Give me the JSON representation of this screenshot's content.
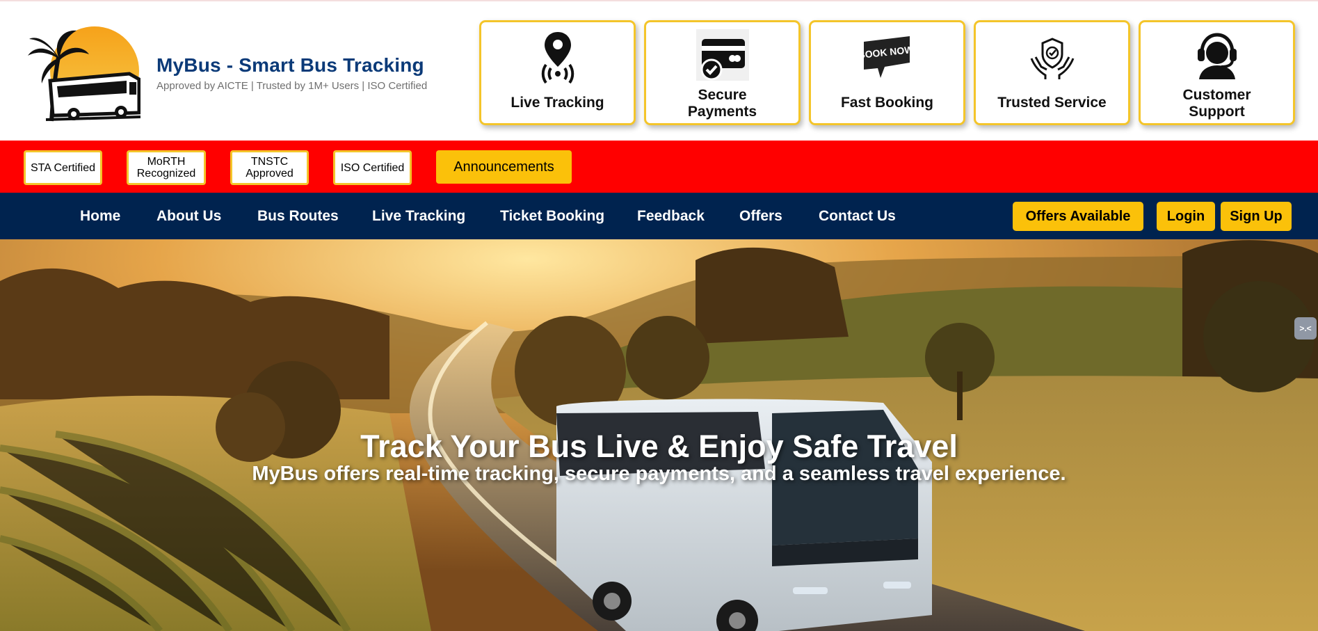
{
  "brand": {
    "title": "MyBus - Smart Bus Tracking",
    "subtitle": "Approved by AICTE | Trusted by 1M+ Users | ISO Certified",
    "logo_icon": "palm-bus-logo"
  },
  "features": [
    {
      "label": "Live Tracking",
      "icon": "location-pin-icon"
    },
    {
      "label": "Secure Payments",
      "icon": "card-check-icon"
    },
    {
      "label": "Fast Booking",
      "icon": "book-now-icon"
    },
    {
      "label": "Trusted Service",
      "icon": "shield-hands-icon"
    },
    {
      "label": "Customer Support",
      "icon": "headset-icon"
    }
  ],
  "certifications": [
    {
      "line1": "STA Certified",
      "line2": ""
    },
    {
      "line1": "MoRTH",
      "line2": "Recognized"
    },
    {
      "line1": "TNSTC",
      "line2": "Approved"
    },
    {
      "line1": "ISO Certified",
      "line2": ""
    }
  ],
  "announcements_label": "Announcements",
  "nav": {
    "items": [
      "Home",
      "About Us",
      "Bus Routes",
      "Live Tracking",
      "Ticket Booking",
      "Feedback",
      "Offers",
      "Contact Us"
    ],
    "offers_button": "Offers Available",
    "login_button": "Login",
    "signup_button": "Sign Up"
  },
  "hero": {
    "title": "Track Your Bus Live & Enjoy Safe Travel",
    "subtitle": "MyBus offers real-time tracking, secure payments, and a seamless travel experience.",
    "side_tab_label": ">.<"
  },
  "colors": {
    "brand_blue": "#0b3a78",
    "cert_bar": "#ff0000",
    "nav_bg": "#00234f",
    "accent_yellow": "#fbc10a",
    "card_border": "#f4c52a"
  }
}
